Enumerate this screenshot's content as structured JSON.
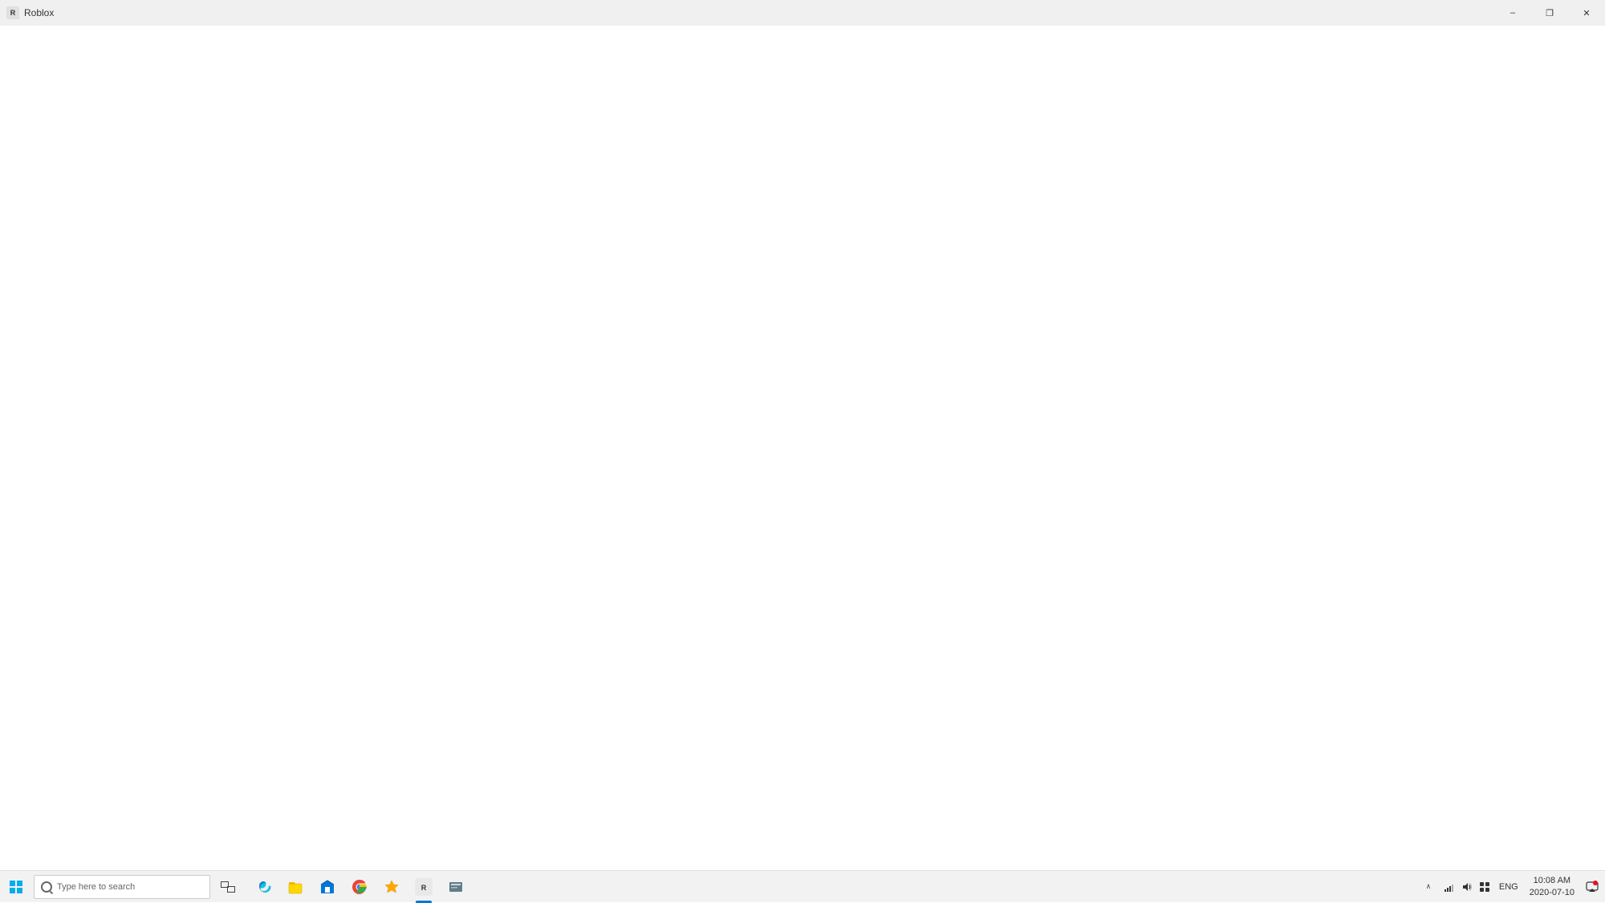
{
  "titlebar": {
    "title": "Roblox",
    "icon": "R",
    "minimize_label": "–",
    "restore_label": "❐",
    "close_label": "✕"
  },
  "main": {
    "background": "#ffffff"
  },
  "taskbar": {
    "search_placeholder": "Type here to search",
    "apps": [
      {
        "name": "task-view",
        "label": "Task View"
      },
      {
        "name": "edge",
        "label": "Microsoft Edge"
      },
      {
        "name": "file-explorer",
        "label": "File Explorer"
      },
      {
        "name": "store",
        "label": "Microsoft Store"
      },
      {
        "name": "chrome",
        "label": "Google Chrome"
      },
      {
        "name": "bookmarks",
        "label": "Bookmarks"
      },
      {
        "name": "roblox",
        "label": "Roblox"
      },
      {
        "name": "app8",
        "label": "App"
      }
    ],
    "tray": {
      "lang": "ENG",
      "time": "10:08 AM",
      "date": "2020-07-10"
    }
  }
}
